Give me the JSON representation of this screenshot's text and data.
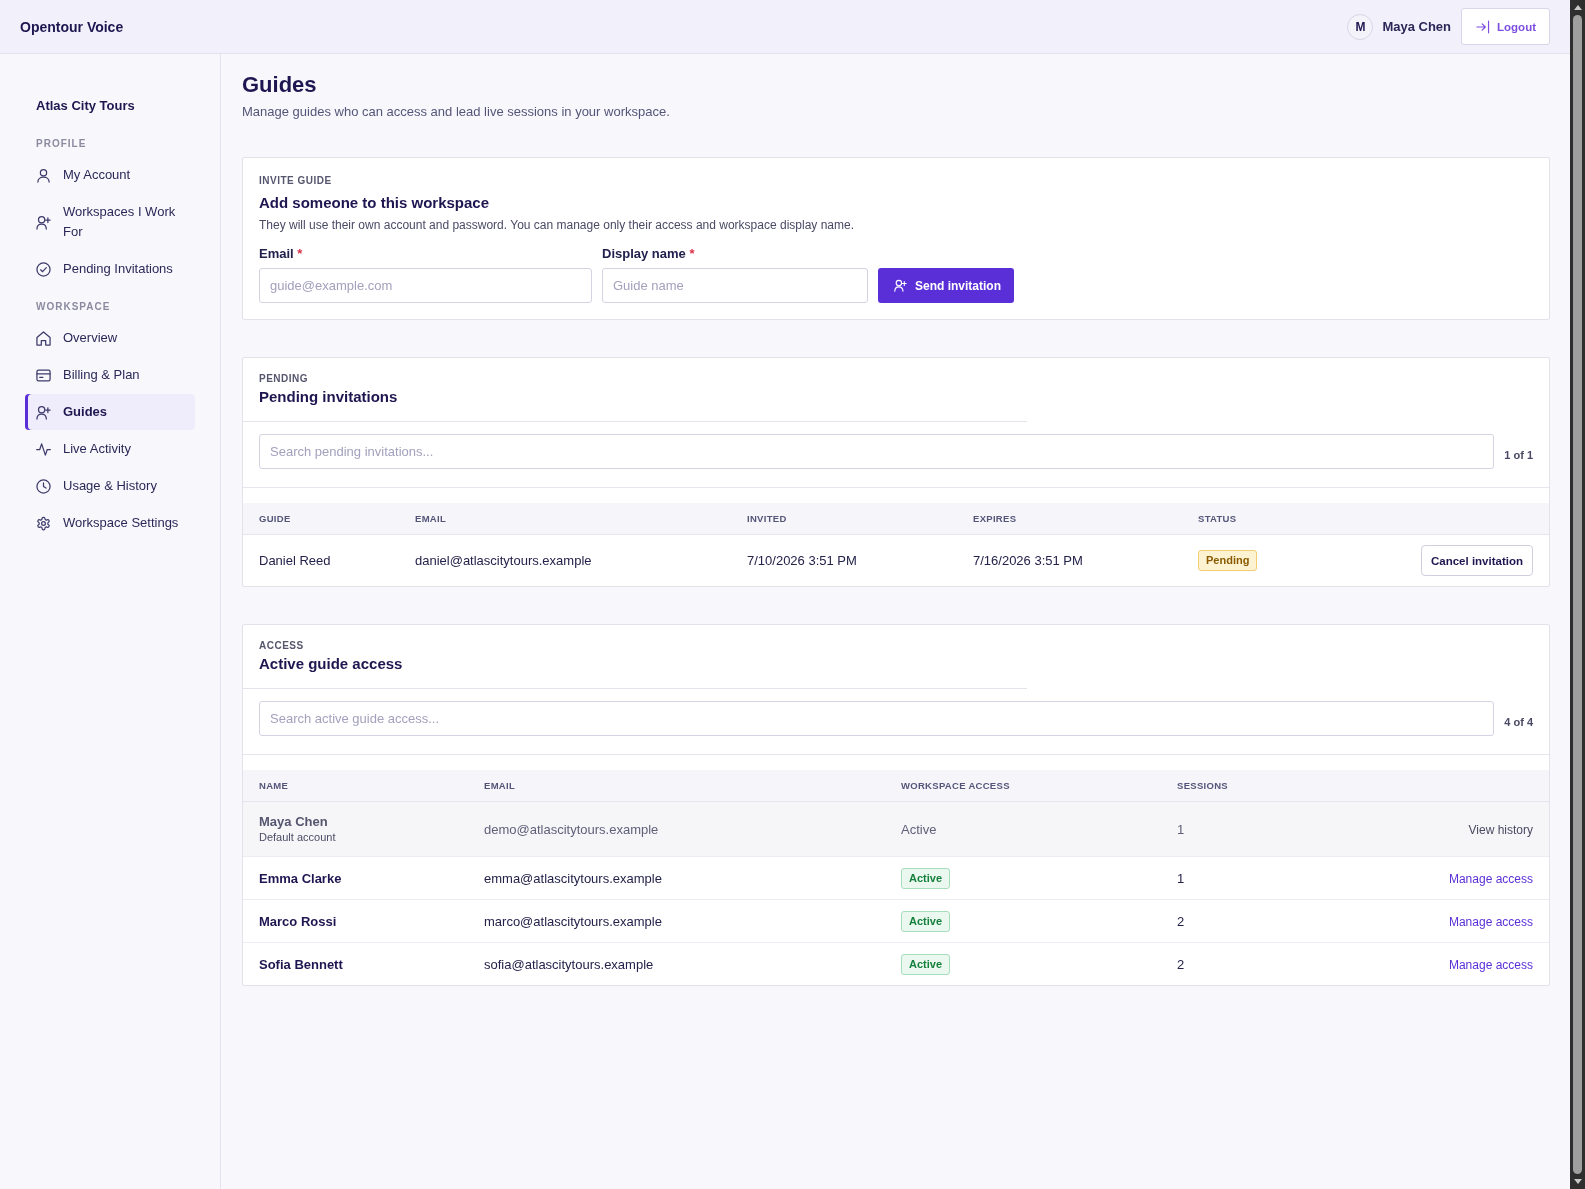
{
  "app": {
    "title": "Opentour Voice"
  },
  "user": {
    "initial": "M",
    "name": "Maya Chen",
    "logout": "Logout"
  },
  "sidebar": {
    "workspace": "Atlas City Tours",
    "sections": [
      {
        "label": "PROFILE",
        "items": [
          {
            "label": "My Account",
            "selected": false
          },
          {
            "label": "Workspaces I Work For",
            "selected": false
          },
          {
            "label": "Pending Invitations",
            "selected": false
          }
        ]
      },
      {
        "label": "WORKSPACE",
        "items": [
          {
            "label": "Overview",
            "selected": false
          },
          {
            "label": "Billing & Plan",
            "selected": false
          },
          {
            "label": "Guides",
            "selected": true
          },
          {
            "label": "Live Activity",
            "selected": false
          },
          {
            "label": "Usage & History",
            "selected": false
          },
          {
            "label": "Workspace Settings",
            "selected": false
          }
        ]
      }
    ]
  },
  "page": {
    "title": "Guides",
    "subtitle": "Manage guides who can access and lead live sessions in your workspace."
  },
  "invite": {
    "eyebrow": "INVITE GUIDE",
    "title": "Add someone to this workspace",
    "description": "They will use their own account and password. You can manage only their access and workspace display name.",
    "fields": [
      {
        "label": "Email",
        "required_mark": "*",
        "placeholder": "guide@example.com"
      },
      {
        "label": "Display name",
        "required_mark": "*",
        "placeholder": "Guide name"
      }
    ],
    "submit": "Send invitation"
  },
  "pending": {
    "eyebrow": "PENDING",
    "title": "Pending invitations",
    "search": {
      "placeholder": "Search pending invitations..."
    },
    "count": "1 of 1",
    "table": {
      "columns": [
        "GUIDE",
        "EMAIL",
        "INVITED",
        "EXPIRES",
        "STATUS"
      ],
      "rows": [
        {
          "guide": "Daniel Reed",
          "email": "daniel@atlascitytours.example",
          "invited": "7/10/2026 3:51 PM",
          "expires": "7/16/2026 3:51 PM",
          "status": "Pending",
          "action": "Cancel invitation"
        }
      ]
    }
  },
  "access": {
    "eyebrow": "ACCESS",
    "title": "Active guide access",
    "search": {
      "placeholder": "Search active guide access..."
    },
    "count": "4 of 4",
    "table": {
      "columns": [
        "NAME",
        "EMAIL",
        "WORKSPACE ACCESS",
        "SESSIONS"
      ],
      "rows": [
        {
          "kind": "default",
          "name": "Maya Chen",
          "note": "Default account",
          "email": "demo@atlascitytours.example",
          "access": "Active",
          "sessions": "1",
          "action": "View history"
        },
        {
          "kind": "guide",
          "name": "Emma Clarke",
          "email": "emma@atlascitytours.example",
          "access": "Active",
          "sessions": "1",
          "action": "Manage access"
        },
        {
          "kind": "guide",
          "name": "Marco Rossi",
          "email": "marco@atlascitytours.example",
          "access": "Active",
          "sessions": "2",
          "action": "Manage access"
        },
        {
          "kind": "guide",
          "name": "Sofia Bennett",
          "email": "sofia@atlascitytours.example",
          "access": "Active",
          "sessions": "2",
          "action": "Manage access"
        }
      ]
    }
  }
}
